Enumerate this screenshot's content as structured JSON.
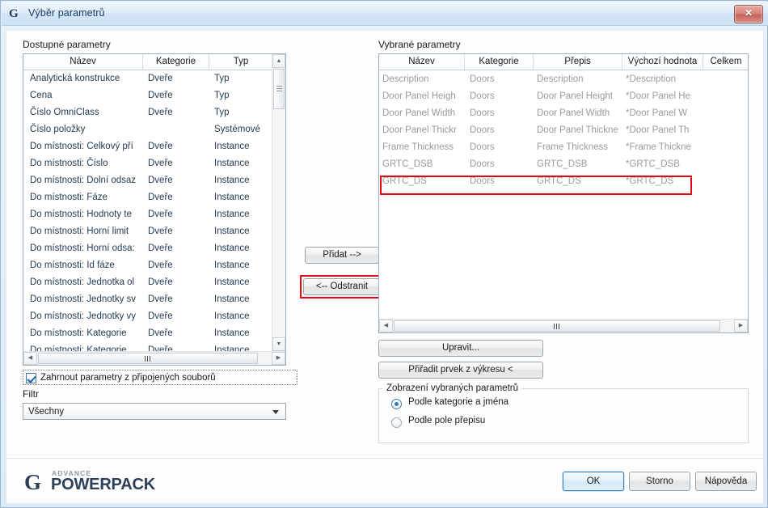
{
  "window": {
    "title": "Výběr parametrů",
    "logo_glyph": "G",
    "close_glyph": "✕"
  },
  "available": {
    "label": "Dostupné parametry",
    "columns": [
      "Název",
      "Kategorie",
      "Typ"
    ],
    "rows": [
      [
        "Analytická konstrukce",
        "Dveře",
        "Typ"
      ],
      [
        "Cena",
        "Dveře",
        "Typ"
      ],
      [
        "Číslo OmniClass",
        "Dveře",
        "Typ"
      ],
      [
        "Číslo položky",
        "",
        "Systémové"
      ],
      [
        "Do místnosti: Celkový pří",
        "Dveře",
        "Instance"
      ],
      [
        "Do místnosti: Číslo",
        "Dveře",
        "Instance"
      ],
      [
        "Do místnosti: Dolní odsaz",
        "Dveře",
        "Instance"
      ],
      [
        "Do místnosti: Fáze",
        "Dveře",
        "Instance"
      ],
      [
        "Do místnosti: Hodnoty te",
        "Dveře",
        "Instance"
      ],
      [
        "Do místnosti: Horní limit",
        "Dveře",
        "Instance"
      ],
      [
        "Do místnosti: Horní odsa:",
        "Dveře",
        "Instance"
      ],
      [
        "Do místnosti: Id fáze",
        "Dveře",
        "Instance"
      ],
      [
        "Do místnosti: Jednotka ol",
        "Dveře",
        "Instance"
      ],
      [
        "Do místnosti: Jednotky sv",
        "Dveře",
        "Instance"
      ],
      [
        "Do místnosti: Jednotky vy",
        "Dveře",
        "Instance"
      ],
      [
        "Do místnosti: Kategorie",
        "Dveře",
        "Instance"
      ],
      [
        "Do místnosti: Kategorie",
        "Dveře",
        "Instance"
      ]
    ]
  },
  "selected": {
    "label": "Vybrané parametry",
    "columns": [
      "Název",
      "Kategorie",
      "Přepis",
      "Výchozí hodnota",
      "Celkem"
    ],
    "rows": [
      [
        "Description",
        "Doors",
        "Description",
        "*Description",
        ""
      ],
      [
        "Door Panel Heigh",
        "Doors",
        "Door Panel Height",
        "*Door Panel He",
        ""
      ],
      [
        "Door Panel Width",
        "Doors",
        "Door Panel Width",
        "*Door Panel W",
        ""
      ],
      [
        "Door Panel Thickr",
        "Doors",
        "Door Panel Thickne",
        "*Door Panel Th",
        ""
      ],
      [
        "Frame Thickness",
        "Doors",
        "Frame Thickness",
        "*Frame Thickne",
        ""
      ],
      [
        "GRTC_DSB",
        "Doors",
        "GRTC_DSB",
        "*GRTC_DSB",
        ""
      ],
      [
        "GRTC_DS",
        "Doors",
        "GRTC_DS",
        "*GRTC_DS",
        ""
      ]
    ],
    "highlighted_row_index": 6
  },
  "transfer": {
    "add_label": "Přidat -->",
    "remove_label": "<-- Odstranit"
  },
  "left_options": {
    "include_linked_label": "Zahrnout parametry z připojených souborů",
    "include_linked_checked": true,
    "filter_label": "Filtr",
    "filter_value": "Všechny"
  },
  "right_actions": {
    "edit_label": "Upravit...",
    "pick_label": "Přiřadit prvek z výkresu <"
  },
  "display_group": {
    "title": "Zobrazení vybraných parametrů",
    "options": [
      {
        "label": "Podle kategorie a jména",
        "selected": true
      },
      {
        "label": "Podle pole přepisu",
        "selected": false
      }
    ]
  },
  "footer": {
    "brand_mark": "G",
    "brand_top": "ADVANCE",
    "brand_main": "POWERPACK",
    "ok_label": "OK",
    "cancel_label": "Storno",
    "help_label": "Nápověda"
  },
  "colors": {
    "highlight": "#e30613",
    "title_text": "#173c63",
    "selected_row_text": "#9a9a9a",
    "available_row_text": "#243b53"
  }
}
